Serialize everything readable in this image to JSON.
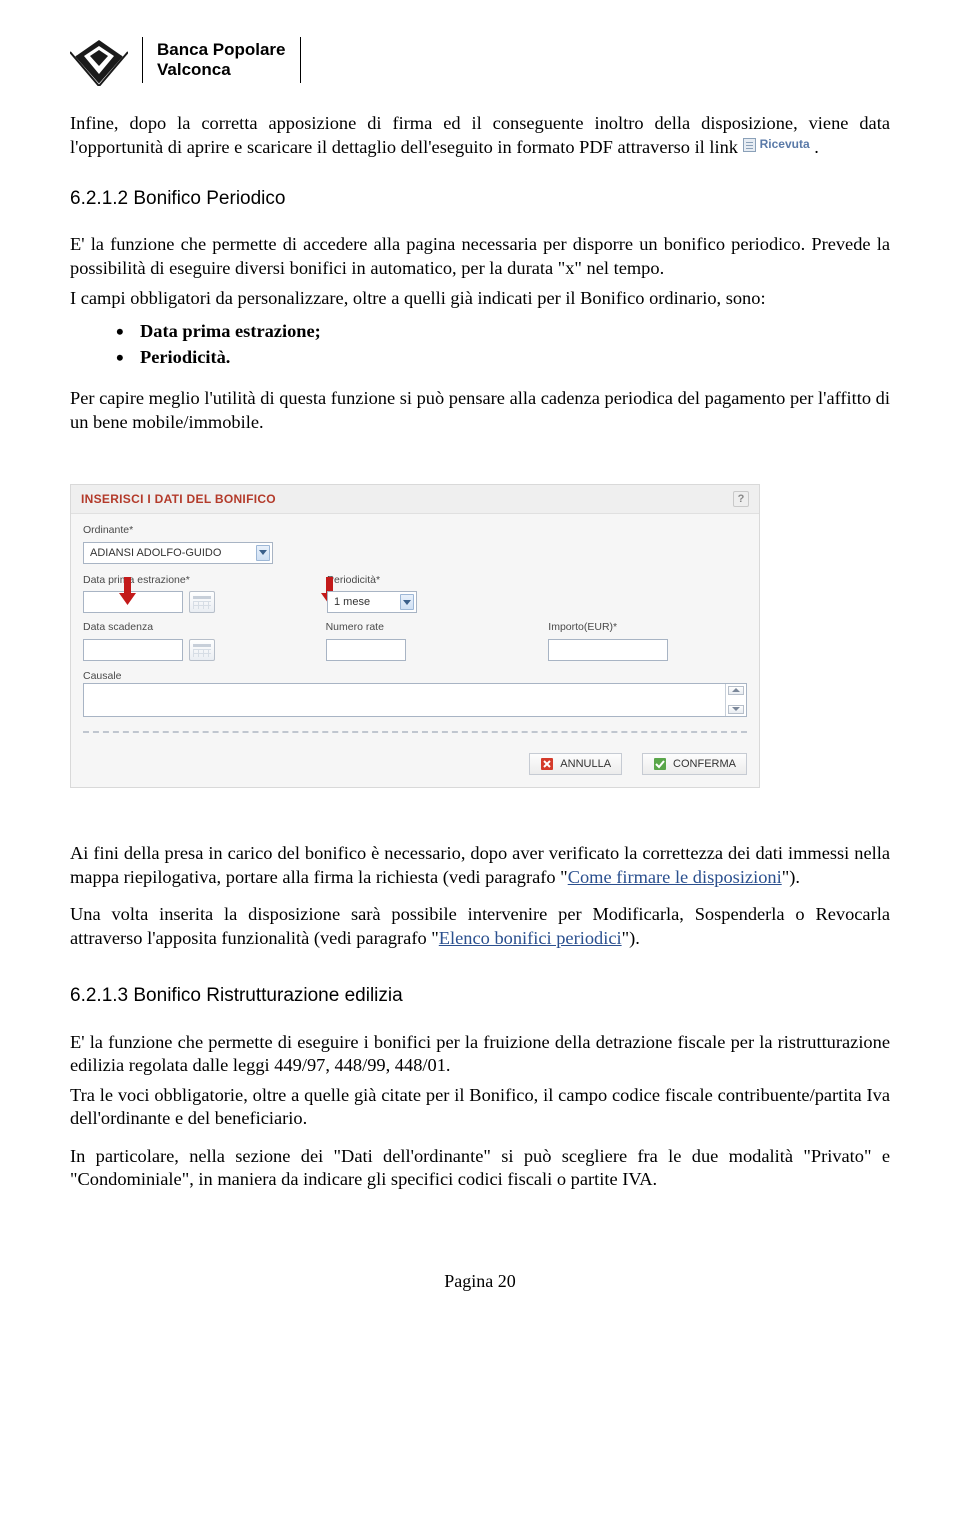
{
  "brand": {
    "line1": "Banca Popolare",
    "line2": "Valconca"
  },
  "p1_a": "Infine, dopo la corretta apposizione di firma ed il conseguente inoltro della disposizione, viene data l'opportunità di aprire e scaricare il dettaglio dell'eseguito in formato PDF attraverso il link ",
  "ricevuta": "Ricevuta",
  "p1_b": " .",
  "sec1_num": "6.2.1.2 Bonifico Periodico",
  "p2": "E' la funzione che permette di accedere alla pagina necessaria per disporre un bonifico periodico. Prevede la possibilità di eseguire diversi bonifici in automatico, per la durata \"x\" nel tempo.",
  "p3": "I campi obbligatori da personalizzare, oltre a quelli già indicati per il Bonifico ordinario, sono:",
  "bul1": "Data prima estrazione;",
  "bul2": "Periodicità.",
  "p4": "Per capire meglio l'utilità di questa funzione si può pensare alla cadenza periodica del pagamento per l'affitto di un bene mobile/immobile.",
  "form": {
    "title": "INSERISCI I DATI DEL BONIFICO",
    "ordinante_lbl": "Ordinante*",
    "ordinante_val": "ADIANSI ADOLFO-GUIDO",
    "dpe_lbl": "Data prima estrazione*",
    "period_lbl": "Periodicità*",
    "period_val": "1 mese",
    "dscad_lbl": "Data scadenza",
    "nrate_lbl": "Numero rate",
    "importo_lbl": "Importo(EUR)*",
    "causale_lbl": "Causale",
    "btn_cancel": "ANNULLA",
    "btn_confirm": "CONFERMA"
  },
  "p5_a": "Ai fini della presa in carico del bonifico è necessario, dopo aver verificato la correttezza dei dati immessi nella mappa riepilogativa, portare alla firma la richiesta (vedi paragrafo \"",
  "link1": "Come firmare le disposizioni",
  "p5_b": "\").",
  "p6_a": "Una volta inserita la disposizione sarà possibile intervenire per Modificarla, Sospenderla o Revocarla attraverso l'apposita funzionalità (vedi paragrafo \"",
  "link2": "Elenco bonifici periodici",
  "p6_b": "\").",
  "sec2_num": "6.2.1.3 Bonifico Ristrutturazione edilizia",
  "p7": "E' la funzione che permette di eseguire i bonifici per la fruizione della detrazione fiscale per la ristrutturazione edilizia regolata dalle leggi 449/97, 448/99, 448/01.",
  "p8": "Tra le voci obbligatorie, oltre a quelle già citate per il Bonifico, il campo codice fiscale contribuente/partita Iva dell'ordinante e del beneficiario.",
  "p9": "In particolare, nella sezione dei \"Dati dell'ordinante\" si può scegliere fra le due modalità \"Privato\" e \"Condominiale\", in maniera da indicare gli specifici codici fiscali o partite IVA.",
  "page_footer": "Pagina 20"
}
